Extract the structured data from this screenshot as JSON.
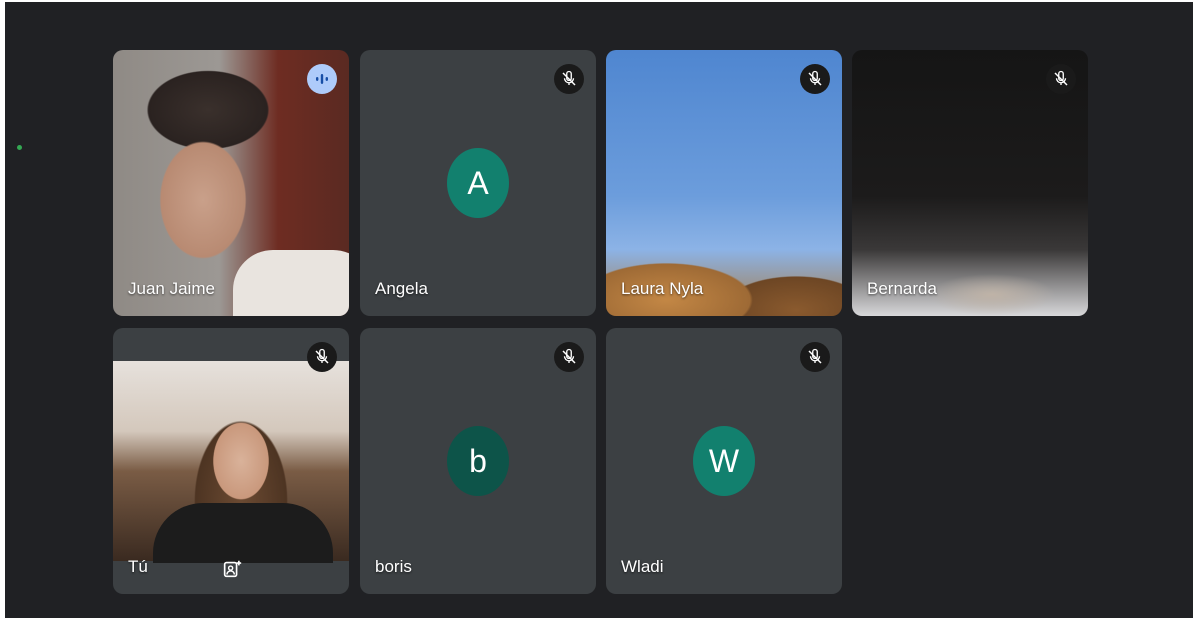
{
  "participants": [
    {
      "name": "Juan Jaime",
      "speaking": true
    },
    {
      "name": "Angela",
      "initial": "A",
      "avatar_color": "#12806e"
    },
    {
      "name": "Laura Nyla"
    },
    {
      "name": "Bernarda"
    },
    {
      "name": "Tú"
    },
    {
      "name": "boris",
      "initial": "b",
      "avatar_color": "#0d5449"
    },
    {
      "name": "Wladi",
      "initial": "W",
      "avatar_color": "#12806e"
    }
  ],
  "icons": {
    "muted": "mic-off-icon",
    "speaking": "audio-level-icon",
    "self_action": "person-frame-icon"
  },
  "colors": {
    "background": "#202124",
    "tile": "#3c4043",
    "speaking_indicator": "#aecbfa",
    "online_dot": "#34a853"
  }
}
